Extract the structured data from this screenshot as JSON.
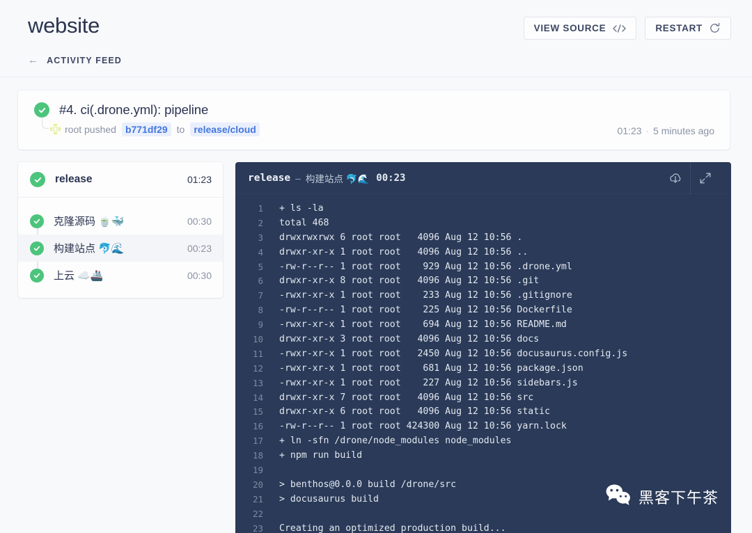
{
  "header": {
    "title": "website",
    "view_source_label": "VIEW SOURCE",
    "restart_label": "RESTART",
    "breadcrumb_label": "ACTIVITY FEED",
    "breadcrumb_arrow": "←"
  },
  "build": {
    "title": "#4. ci(.drone.yml): pipeline",
    "actor": "root pushed",
    "commit": "b771df29",
    "to_label": "to",
    "branch": "release/cloud",
    "duration": "01:23",
    "separator": "·",
    "relative_time": "5 minutes ago",
    "status": "success"
  },
  "steps": {
    "head": {
      "label": "release",
      "time": "01:23",
      "status": "success"
    },
    "items": [
      {
        "label": "克隆源码 🍵🐳",
        "time": "00:30",
        "status": "success",
        "active": false
      },
      {
        "label": "构建站点 🐬🌊",
        "time": "00:23",
        "status": "success",
        "active": true
      },
      {
        "label": "上云 ☁️🚢",
        "time": "00:30",
        "status": "success",
        "active": false
      }
    ]
  },
  "console": {
    "pipeline": "release",
    "dash": "–",
    "stage": "构建站点 🐬🌊",
    "duration": "00:23",
    "download_icon": "cloud-download-icon",
    "expand_icon": "expand-icon",
    "lines": [
      {
        "n": "1",
        "t": "+ ls -la"
      },
      {
        "n": "2",
        "t": "total 468"
      },
      {
        "n": "3",
        "t": "drwxrwxrwx 6 root root   4096 Aug 12 10:56 ."
      },
      {
        "n": "4",
        "t": "drwxr-xr-x 1 root root   4096 Aug 12 10:56 .."
      },
      {
        "n": "5",
        "t": "-rw-r--r-- 1 root root    929 Aug 12 10:56 .drone.yml"
      },
      {
        "n": "6",
        "t": "drwxr-xr-x 8 root root   4096 Aug 12 10:56 .git"
      },
      {
        "n": "7",
        "t": "-rwxr-xr-x 1 root root    233 Aug 12 10:56 .gitignore"
      },
      {
        "n": "8",
        "t": "-rw-r--r-- 1 root root    225 Aug 12 10:56 Dockerfile"
      },
      {
        "n": "9",
        "t": "-rwxr-xr-x 1 root root    694 Aug 12 10:56 README.md"
      },
      {
        "n": "10",
        "t": "drwxr-xr-x 3 root root   4096 Aug 12 10:56 docs"
      },
      {
        "n": "11",
        "t": "-rwxr-xr-x 1 root root   2450 Aug 12 10:56 docusaurus.config.js"
      },
      {
        "n": "12",
        "t": "-rwxr-xr-x 1 root root    681 Aug 12 10:56 package.json"
      },
      {
        "n": "13",
        "t": "-rwxr-xr-x 1 root root    227 Aug 12 10:56 sidebars.js"
      },
      {
        "n": "14",
        "t": "drwxr-xr-x 7 root root   4096 Aug 12 10:56 src"
      },
      {
        "n": "15",
        "t": "drwxr-xr-x 6 root root   4096 Aug 12 10:56 static"
      },
      {
        "n": "16",
        "t": "-rw-r--r-- 1 root root 424300 Aug 12 10:56 yarn.lock"
      },
      {
        "n": "17",
        "t": "+ ln -sfn /drone/node_modules node_modules"
      },
      {
        "n": "18",
        "t": "+ npm run build"
      },
      {
        "n": "19",
        "t": ""
      },
      {
        "n": "20",
        "t": "> benthos@0.0.0 build /drone/src"
      },
      {
        "n": "21",
        "t": "> docusaurus build"
      },
      {
        "n": "22",
        "t": ""
      },
      {
        "n": "23",
        "t": "Creating an optimized production build..."
      }
    ]
  },
  "watermark": {
    "text": "黑客下午茶",
    "icon": "wechat-icon"
  },
  "colors": {
    "page_bg": "#f8f9fb",
    "card_bg": "#fdfdfe",
    "text_primary": "#2b3450",
    "text_muted": "#8b92a5",
    "success": "#4cc47c",
    "link": "#4477dd",
    "link_bg": "#e9effc",
    "console_bg": "#2a3a58"
  }
}
